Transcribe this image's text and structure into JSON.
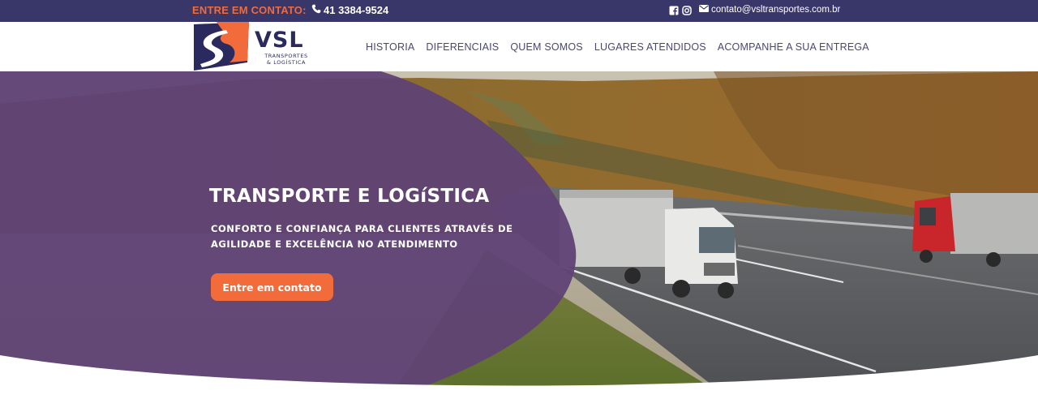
{
  "topbar": {
    "contact_label": "ENTRE EM CONTATO:",
    "phone": "41 3384-9524",
    "email": "contato@vsltransportes.com.br",
    "icons": [
      "phone-icon",
      "facebook-icon",
      "instagram-icon",
      "envelope-icon"
    ]
  },
  "header": {
    "logo_word": "VSL",
    "logo_sub_line1": "TRANSPORTES",
    "logo_sub_line2": "& LOGÍSTICA",
    "nav": [
      "HISTORIA",
      "DIFERENCIAIS",
      "QUEM SOMOS",
      "LUGARES ATENDIDOS",
      "ACOMPANHE A SUA ENTREGA"
    ]
  },
  "hero": {
    "title": "TRANSPORTE E LOGíSTICA",
    "subtitle": "CONFORTO E CONFIANÇA PARA CLIENTES ATRAVÉS DE AGILIDADE E EXCELÊNCIA NO ATENDIMENTO",
    "cta_label": "Entre em contato"
  },
  "colors": {
    "topbar_bg": "#39366a",
    "accent_orange": "#f26b3a",
    "overlay_purple": "#5b3f78",
    "logo_navy": "#2b2a5e"
  }
}
